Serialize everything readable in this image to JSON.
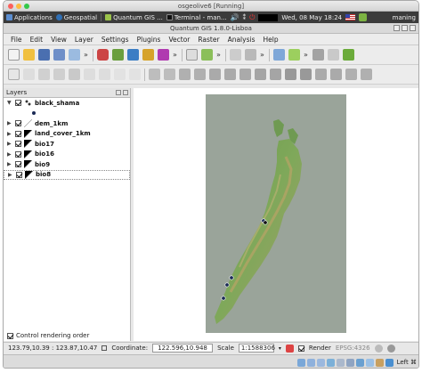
{
  "vbox": {
    "title": "osgeolive6 [Running]"
  },
  "panel": {
    "applications": "Applications",
    "geospatial": "Geospatial",
    "task_qgis": "Quantum GIS ...",
    "task_terminal": "Terminal - man...",
    "datetime": "Wed, 08 May  18:24",
    "user": "maning"
  },
  "qgis": {
    "title": "Quantum GIS 1.8.0-Lisboa",
    "menu": [
      "File",
      "Edit",
      "View",
      "Layer",
      "Settings",
      "Plugins",
      "Vector",
      "Raster",
      "Analysis",
      "Help"
    ]
  },
  "layers": {
    "title": "Layers",
    "items": [
      {
        "name": "black_shama",
        "expanded": true,
        "icon": "point-layer-icon"
      },
      {
        "name": "dem_1km",
        "expanded": false,
        "icon": "raster-layer-icon"
      },
      {
        "name": "land_cover_1km",
        "expanded": false,
        "icon": "raster-layer-icon"
      },
      {
        "name": "bio17",
        "expanded": false,
        "icon": "raster-layer-icon"
      },
      {
        "name": "bio16",
        "expanded": false,
        "icon": "raster-layer-icon"
      },
      {
        "name": "bio9",
        "expanded": false,
        "icon": "raster-layer-icon"
      },
      {
        "name": "bio8",
        "expanded": false,
        "icon": "raster-layer-icon"
      }
    ],
    "control_rendering_order": "Control rendering order"
  },
  "status": {
    "extent": "123.79,10.39 : 123.87,10.47",
    "coordinate_label": "Coordinate:",
    "coordinate_value": "122.596,10.948",
    "scale_label": "Scale",
    "scale_value": "1:1588306",
    "render_label": "Render",
    "epsg": "EPSG:4326"
  },
  "vboxbar": {
    "host_key": "Left ⌘"
  },
  "colors": {
    "panel_bg": "#3b3b3b",
    "map_bg": "#9aa49a",
    "land_green": "#6f9a52"
  }
}
